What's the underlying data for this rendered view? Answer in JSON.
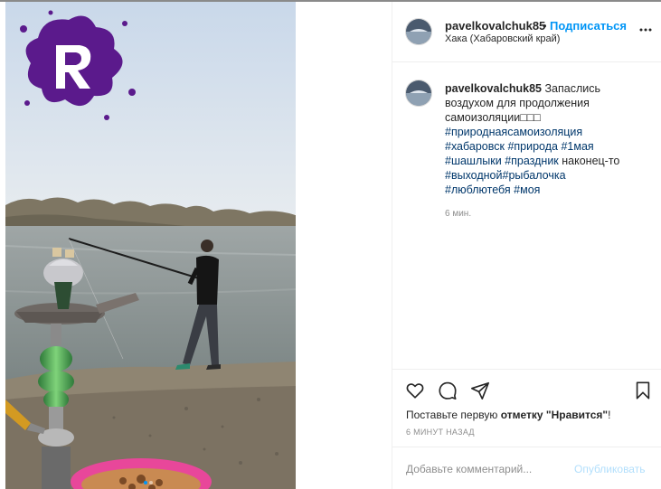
{
  "post": {
    "username": "pavelkovalchuk85",
    "separator": "•",
    "follow_label": "Подписаться",
    "location": "Хака (Хабаровский край)",
    "caption": {
      "username": "pavelkovalchuk85",
      "text_part1": " Запаслись воздухом для продолжения самоизоляции",
      "emoji_placeholder": "□□□",
      "tags_line1": [
        "#природнаясамоизоляция"
      ],
      "line2_tag1": "#хабаровск",
      "line2_tag2": "#природа",
      "line2_tag3": "#1мая",
      "line3_tag1": "#шашлыки",
      "line3_tag2": "#праздник",
      "line3_text": " наконец-то",
      "line4_tag1": "#выходной",
      "line4_tag2": "#рыбалочка",
      "line5_tag1": "#люблютебя",
      "line5_tag2": "#моя"
    },
    "caption_time": "6 мин.",
    "likes_text_before": "Поставьте первую ",
    "likes_text_bold": "отметку \"Нравится\"",
    "likes_text_after": "!",
    "date": "6 МИНУТ НАЗАД",
    "comment_placeholder": "Добавьте комментарий...",
    "post_button": "Опубликовать"
  },
  "icons": {
    "more": "more-horizontal-icon",
    "like": "heart-icon",
    "comment": "comment-bubble-icon",
    "share": "paper-plane-icon",
    "save": "bookmark-icon",
    "watermark": "purple-splash-logo"
  },
  "colors": {
    "link_blue": "#0095f6",
    "hashtag": "#00376b",
    "muted": "#8e8e8e",
    "watermark_purple": "#5b1a8c"
  },
  "carousel": {
    "slides": 2,
    "active_index": 1
  }
}
